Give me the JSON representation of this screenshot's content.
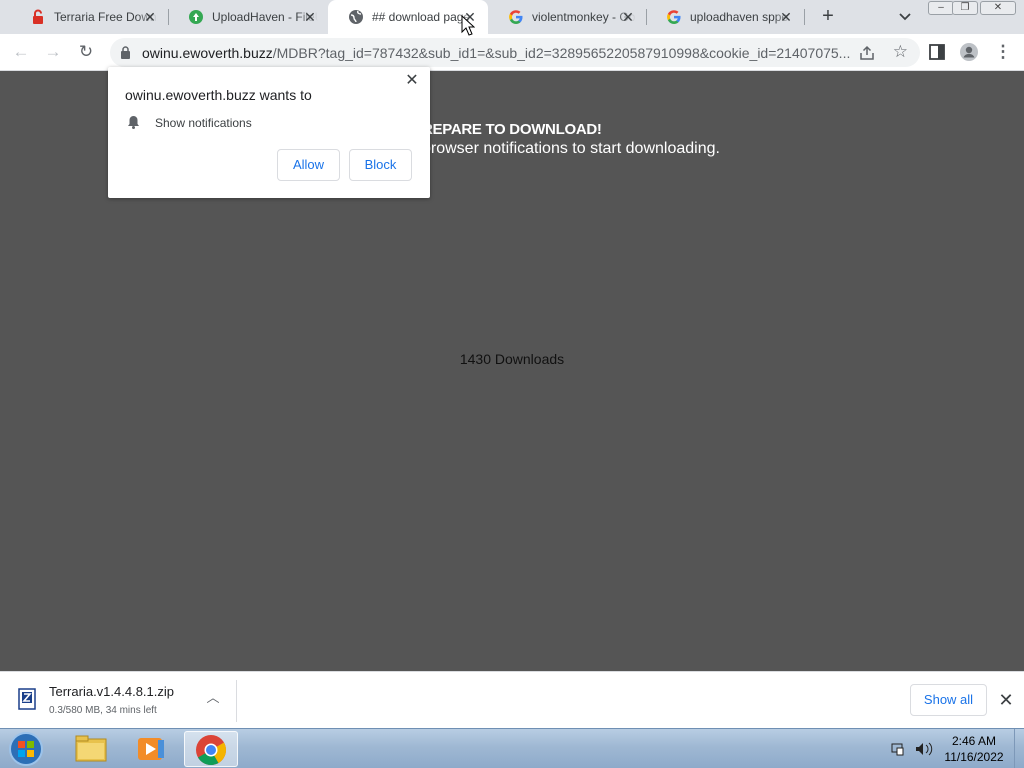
{
  "tabs": [
    {
      "title": "Terraria Free Download",
      "icon": "unlock-icon",
      "color": "#d93025"
    },
    {
      "title": "UploadHaven - FileUpload",
      "icon": "uploadhaven-icon",
      "color": "#34a853"
    },
    {
      "title": "## download page",
      "icon": "globe-icon",
      "color": "#5f6368"
    },
    {
      "title": "violentmonkey - Google",
      "icon": "google-icon",
      "color": "#4285f4"
    },
    {
      "title": "uploadhaven sppe",
      "icon": "google-icon",
      "color": "#4285f4"
    }
  ],
  "address_bar": {
    "domain": "owinu.ewoverth.buzz",
    "path": "/MDBR?tag_id=787432&sub_id1=&sub_id2=3289565220587910998&cookie_id=21407075..."
  },
  "page": {
    "headline": "REPARE TO DOWNLOAD!",
    "subline": "browser notifications to start downloading.",
    "downloads_count": "1430 Downloads",
    "background_color": "#555555"
  },
  "permission_popup": {
    "title": "owinu.ewoverth.buzz wants to",
    "permission_text": "Show notifications",
    "allow_label": "Allow",
    "block_label": "Block"
  },
  "download_shelf": {
    "filename": "Terraria.v1.4.4.8.1.zip",
    "status": "0.3/580 MB, 34 mins left",
    "show_all_label": "Show all"
  },
  "taskbar": {
    "time": "2:46 AM",
    "date": "11/16/2022"
  }
}
